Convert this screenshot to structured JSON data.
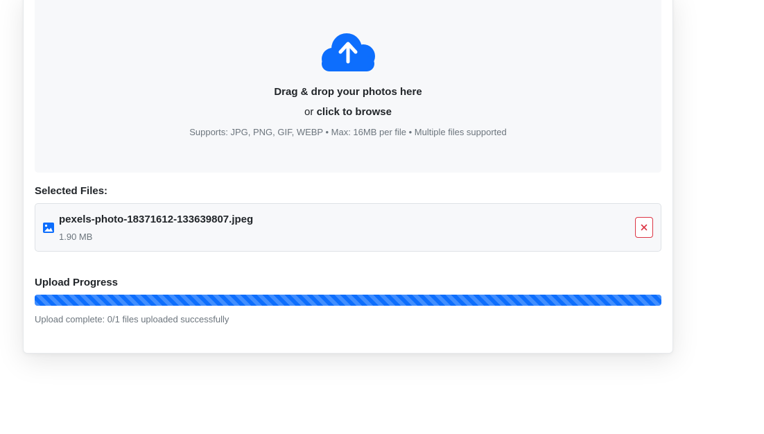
{
  "dropzone": {
    "icon": "cloud-upload-icon",
    "title": "Drag & drop your photos here",
    "or_text": "or",
    "browse_text": "click to browse",
    "hint": "Supports: JPG, PNG, GIF, WEBP • Max: 16MB per file • Multiple files supported",
    "accent_color": "#0d6efd"
  },
  "selected_files": {
    "label": "Selected Files:",
    "items": [
      {
        "icon": "image-icon",
        "name": "pexels-photo-18371612-133639807.jpeg",
        "size": "1.90 MB",
        "remove_label": "×"
      }
    ]
  },
  "upload_progress": {
    "label": "Upload Progress",
    "progress": 1.0,
    "status_text": "Upload complete: 0/1 files uploaded successfully",
    "bar_color": "#0d6efd"
  }
}
